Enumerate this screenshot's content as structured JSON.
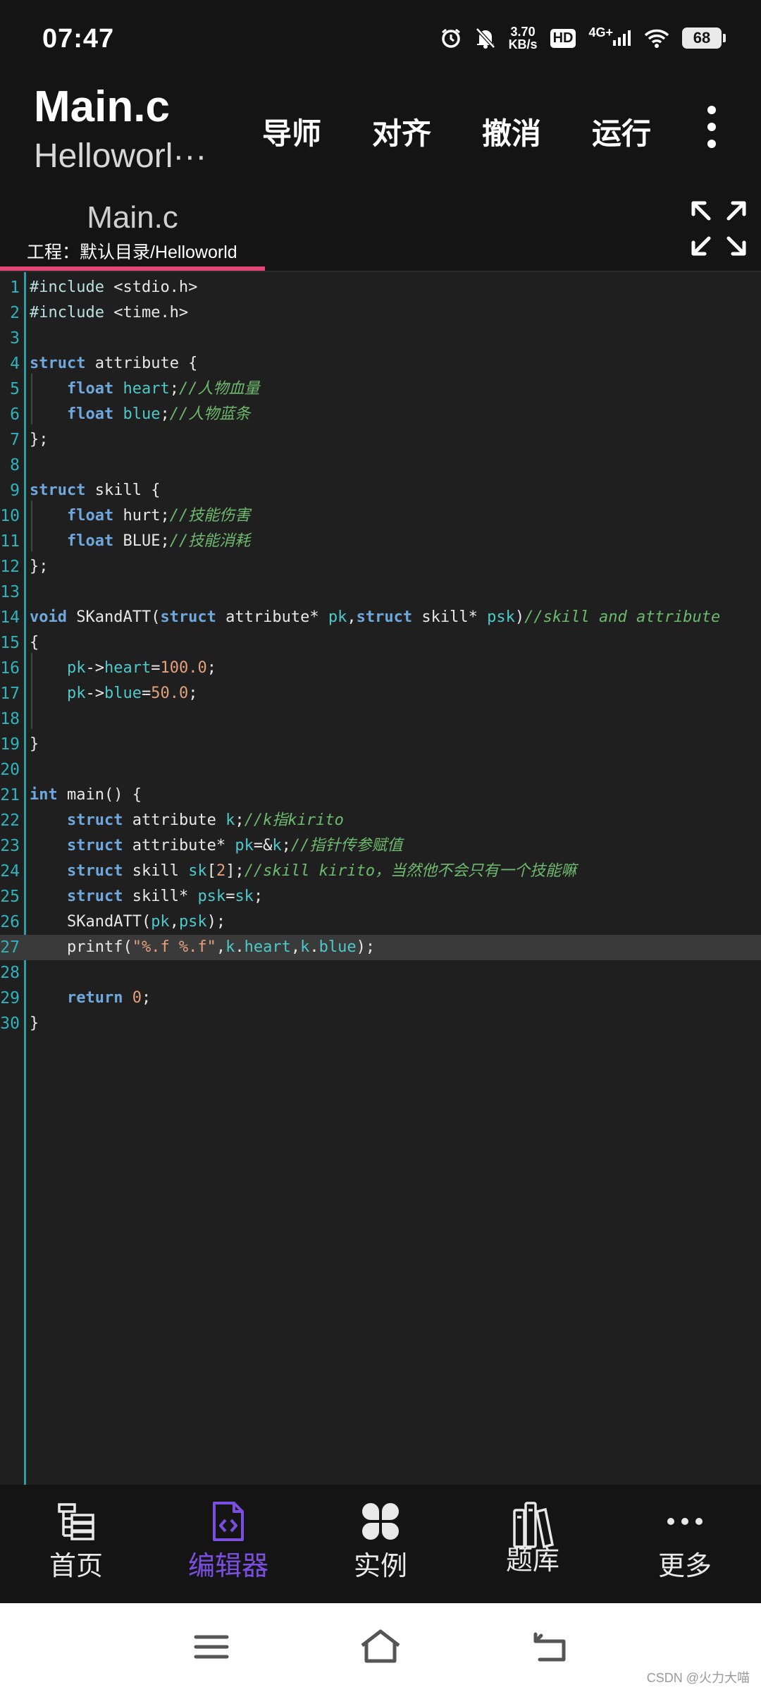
{
  "status": {
    "time": "07:47",
    "speed_value": "3.70",
    "speed_unit": "KB/s",
    "hd": "HD",
    "network": "4G+",
    "battery": "68"
  },
  "header": {
    "title": "Main.c",
    "subtitle": "Helloworl···",
    "menu": [
      "导师",
      "对齐",
      "撤消",
      "运行"
    ]
  },
  "tab": {
    "name": "Main.c",
    "project": "工程：默认目录/Helloworld"
  },
  "editor": {
    "active_line": 27,
    "lines": [
      {
        "n": "1",
        "code": "#include <stdio.h>"
      },
      {
        "n": "2",
        "code": "#include <time.h>"
      },
      {
        "n": "3",
        "code": ""
      },
      {
        "n": "4",
        "code": "struct attribute {"
      },
      {
        "n": "5",
        "code": "    float heart;//人物血量"
      },
      {
        "n": "6",
        "code": "    float blue;//人物蓝条"
      },
      {
        "n": "7",
        "code": "};"
      },
      {
        "n": "8",
        "code": ""
      },
      {
        "n": "9",
        "code": "struct skill {"
      },
      {
        "n": "10",
        "code": "    float hurt;//技能伤害"
      },
      {
        "n": "11",
        "code": "    float BLUE;//技能消耗"
      },
      {
        "n": "12",
        "code": "};"
      },
      {
        "n": "13",
        "code": ""
      },
      {
        "n": "14",
        "code": "void SKandATT(struct attribute* pk,struct skill* psk)//skill and attribute"
      },
      {
        "n": "15",
        "code": "{"
      },
      {
        "n": "16",
        "code": "    pk->heart=100.0;"
      },
      {
        "n": "17",
        "code": "    pk->blue=50.0;"
      },
      {
        "n": "18",
        "code": ""
      },
      {
        "n": "19",
        "code": "}"
      },
      {
        "n": "20",
        "code": ""
      },
      {
        "n": "21",
        "code": "int main() {"
      },
      {
        "n": "22",
        "code": "    struct attribute k;//k指kirito"
      },
      {
        "n": "23",
        "code": "    struct attribute* pk=&k;//指针传参赋值"
      },
      {
        "n": "24",
        "code": "    struct skill sk[2];//skill kirito，当然他不会只有一个技能嘛"
      },
      {
        "n": "25",
        "code": "    struct skill* psk=sk;"
      },
      {
        "n": "26",
        "code": "    SKandATT(pk,psk);"
      },
      {
        "n": "27",
        "code": "    printf(\"%.f %.f\",k.heart,k.blue);"
      },
      {
        "n": "28",
        "code": ""
      },
      {
        "n": "29",
        "code": "    return 0;"
      },
      {
        "n": "30",
        "code": "}"
      }
    ]
  },
  "nav": [
    {
      "label": "首页",
      "icon": "home-tree-icon"
    },
    {
      "label": "编辑器",
      "icon": "code-file-icon",
      "active": true
    },
    {
      "label": "实例",
      "icon": "clover-icon"
    },
    {
      "label": "题库",
      "icon": "books-icon"
    },
    {
      "label": "更多",
      "icon": "more-dots-icon"
    }
  ],
  "colors": {
    "accent": "#7a4fe0",
    "tab_underline": "#e6457a",
    "line_numbers": "#2fb3bd"
  },
  "watermark": "CSDN @火力大喵"
}
